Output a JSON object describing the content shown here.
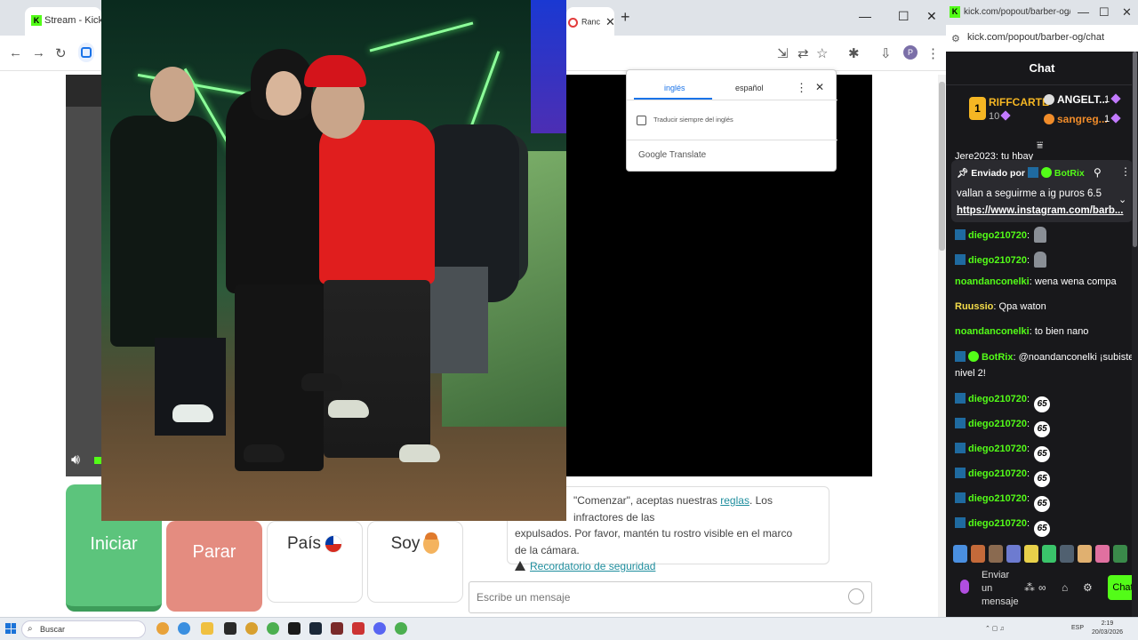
{
  "browser": {
    "tab_left_title": "Stream - Kick Dashboa",
    "tab_right_title": "Ranc",
    "tab_right_close": "✕",
    "new_tab": "+",
    "min": "—",
    "max": "☐",
    "close": "✕"
  },
  "translate_popup": {
    "tab_active": "inglés",
    "tab_other": "español",
    "checkbox_label": "Traducir siempre del inglés",
    "brand": "Google Translate"
  },
  "bottom_buttons": {
    "start": "Iniciar",
    "stop": "Parar",
    "country": "País",
    "self": "Soy"
  },
  "notice": {
    "line1_pre": "\"Comenzar\", aceptas nuestras ",
    "line1_link": "reglas",
    "line1_post": ". Los infractores de las",
    "line2": "expulsados. Por favor, mantén tu rostro visible en el marco",
    "line3": "de la cámara.",
    "safety_link": "Recordatorio de seguridad"
  },
  "message_input": {
    "placeholder": "Escribe un mensaje"
  },
  "chat_window": {
    "tab_title": "kick.com/popout/barber-og/chat",
    "url": "kick.com/popout/barber-og/chat",
    "header": "Chat",
    "leaderboard": {
      "first_rank": "1",
      "first_name": "RIFFCARTE",
      "first_count": "10",
      "second_name": "ANGELT...",
      "second_count": "1",
      "third_name": "sangreg...",
      "third_count": "1"
    },
    "partial_line": "Jere2023: tu hbay",
    "pinned": {
      "label": "Enviado por",
      "author": "BotRix",
      "message": "vallan a seguirme a ig puros 6.5",
      "link": "https://www.instagram.com/barb..."
    },
    "messages": [
      {
        "user": "diego210720",
        "text": "",
        "emote": "bird"
      },
      {
        "user": "diego210720",
        "text": "",
        "emote": "bird"
      },
      {
        "user": "noandanconelki",
        "text": "wena wena compa",
        "emote": ""
      },
      {
        "user": "Ruussio",
        "text": "Qpa waton",
        "emote": ""
      },
      {
        "user": "noandanconelki",
        "text": "to bien nano",
        "emote": ""
      },
      {
        "user": "BotRix",
        "text": "@noandanconelki ¡subiste al",
        "text2": "nivel 2!",
        "emote": ""
      },
      {
        "user": "diego210720",
        "text": "",
        "emote": "65"
      },
      {
        "user": "diego210720",
        "text": "",
        "emote": "65"
      },
      {
        "user": "diego210720",
        "text": "",
        "emote": "65"
      },
      {
        "user": "diego210720",
        "text": "",
        "emote": "65"
      },
      {
        "user": "diego210720",
        "text": "",
        "emote": "65"
      },
      {
        "user": "diego210720",
        "text": "",
        "emote": "65"
      }
    ],
    "emote_65_text": "65",
    "send_label": "Enviar un mensaje",
    "chat_button": "Chat"
  },
  "taskbar": {
    "search": "Buscar",
    "time": "2:19",
    "date": "20/03/2026",
    "lang": "ESP"
  },
  "colors": {
    "kick_green": "#53fc18",
    "start_green": "#5cc47c",
    "stop_red": "#e48c80",
    "link_teal": "#1f8e9e"
  }
}
